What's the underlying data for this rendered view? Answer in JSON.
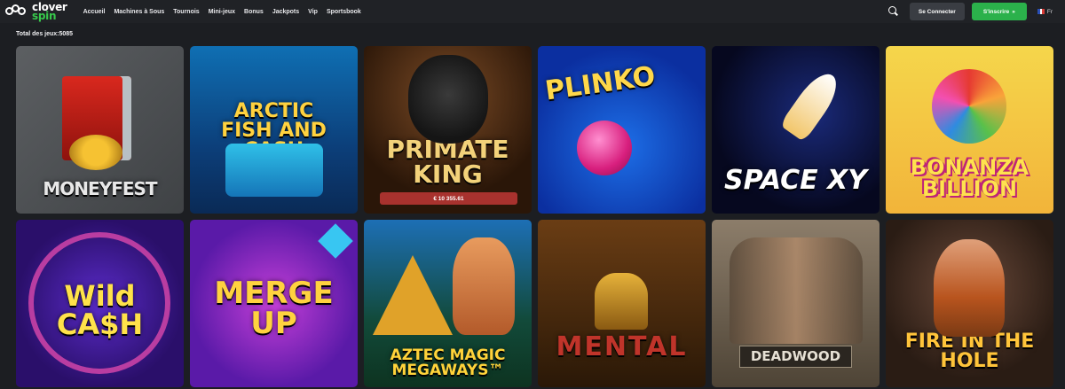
{
  "header": {
    "logo_line1": "clover",
    "logo_line2": "spin",
    "nav": [
      "Accueil",
      "Machines à Sous",
      "Tournois",
      "Mini-jeux",
      "Bonus",
      "Jackpots",
      "Vip",
      "Sportsbook"
    ],
    "login_label": "Se Connecter",
    "register_label": "S'inscrire",
    "register_chevron": "»",
    "language": "Fr"
  },
  "total_label": "Total des jeux:5085",
  "games": [
    {
      "title": "MONEYFEST"
    },
    {
      "title": "ARCTIC FISH AND CASH"
    },
    {
      "title": "PRIMATE KING",
      "jackpot": "€ 10 355.61"
    },
    {
      "title": "PLINKO"
    },
    {
      "title": "SPACE XY"
    },
    {
      "title": "BONANZA BILLION"
    },
    {
      "title": "Wild CA$H"
    },
    {
      "title": "MERGE UP"
    },
    {
      "title": "AZTEC MAGIC MEGAWAYS™"
    },
    {
      "title": "MENTAL"
    },
    {
      "title": "DEADWOOD"
    },
    {
      "title": "FIRE IN THE HOLE"
    }
  ],
  "colors": {
    "accent_green": "#2bb14b",
    "background": "#1c1e22",
    "jackpot_red": "#a8322e"
  }
}
